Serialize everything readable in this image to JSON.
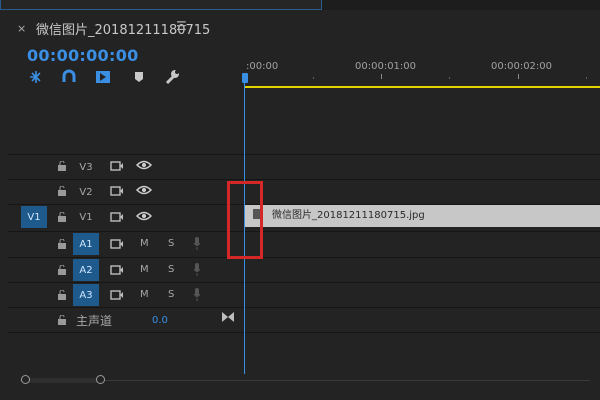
{
  "tab": {
    "close": "×",
    "title": "微信图片_20181211180715",
    "menu_icon": "menu-icon"
  },
  "timecode": "00:00:00:00",
  "tools": [
    "snap-icon",
    "linked-selection-icon",
    "insert-edit-icon",
    "marker-icon",
    "wrench-icon"
  ],
  "ruler": {
    "labels": [
      ":00:00",
      "00:00:01:00",
      "00:00:02:00"
    ]
  },
  "tracks": {
    "video": [
      {
        "source": "",
        "name": "V3",
        "active": false
      },
      {
        "source": "",
        "name": "V2",
        "active": false
      },
      {
        "source": "V1",
        "name": "V1",
        "active": false
      }
    ],
    "audio": [
      {
        "name": "A1",
        "m": "M",
        "s": "S"
      },
      {
        "name": "A2",
        "m": "M",
        "s": "S"
      },
      {
        "name": "A3",
        "m": "M",
        "s": "S"
      }
    ],
    "master": {
      "label": "主声道",
      "value": "0.0"
    }
  },
  "clip": {
    "label": "微信图片_20181211180715.jpg"
  },
  "colors": {
    "accent": "#3b8fe3",
    "active_track": "#1e5a8c",
    "yellow": "#e2d300",
    "highlight": "#d42727"
  }
}
